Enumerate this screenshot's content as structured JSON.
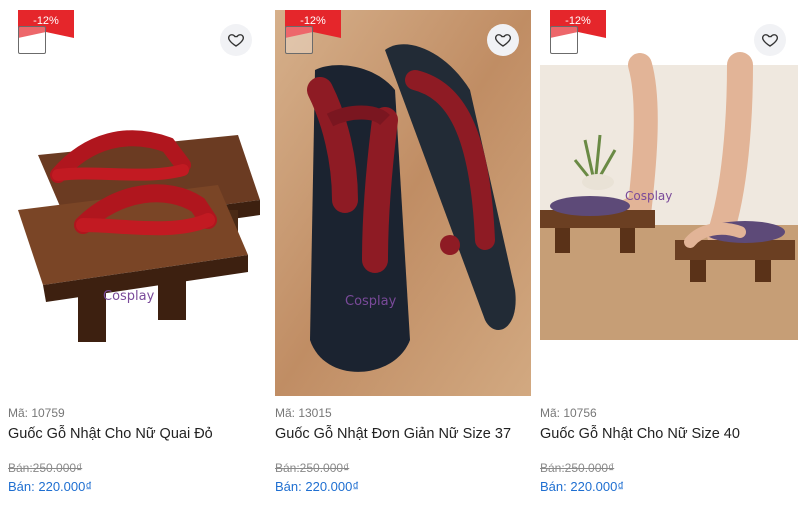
{
  "products": [
    {
      "discount": "-12%",
      "code": "Mã: 10759",
      "name": "Guốc Gỗ Nhật Cho Nữ Quai Đỏ",
      "old_price": "Bán:250.000₫",
      "price": "Bán: 220.000₫",
      "watermark": "Cosplay"
    },
    {
      "discount": "-12%",
      "code": "Mã: 13015",
      "name": "Guốc Gỗ Nhật Đơn Giản Nữ Size 37",
      "old_price": "Bán:250.000₫",
      "price": "Bán: 220.000₫",
      "watermark": "Cosplay"
    },
    {
      "discount": "-12%",
      "code": "Mã: 10756",
      "name": "Guốc Gỗ Nhật Cho Nữ Size 40",
      "old_price": "Bán:250.000₫",
      "price": "Bán: 220.000₫",
      "watermark": "Cosplay"
    }
  ],
  "icons": {
    "wishlist": "heart-icon"
  },
  "colors": {
    "badge": "#e5262b",
    "price": "#1f6fd1",
    "strap": "#9b1f2a"
  }
}
